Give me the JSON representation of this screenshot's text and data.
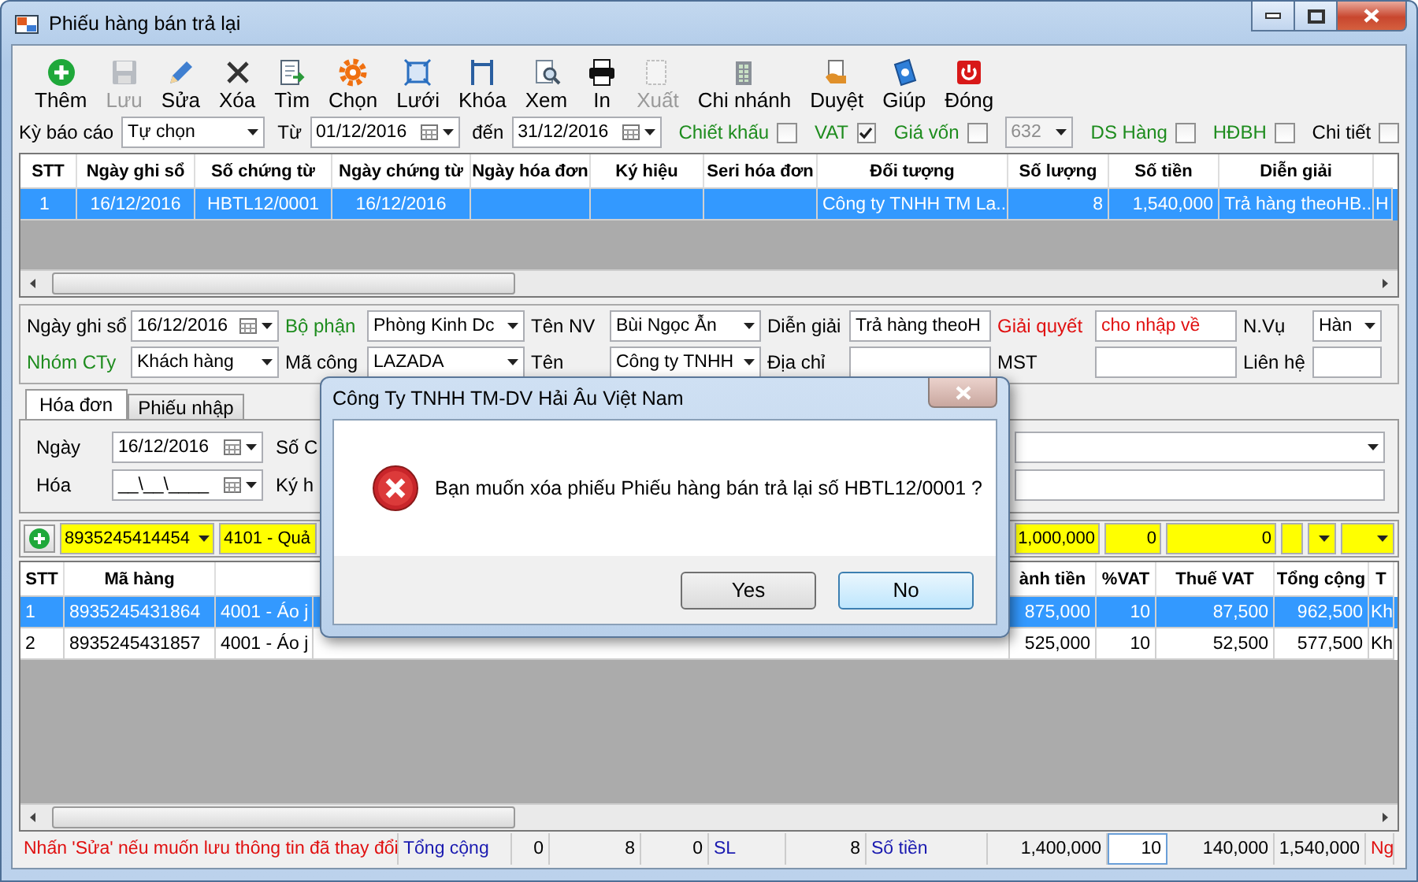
{
  "window": {
    "title": "Phiếu hàng bán trả lại"
  },
  "toolbar": [
    {
      "label": "Thêm",
      "kind": "add",
      "disabled": false
    },
    {
      "label": "Lưu",
      "kind": "save",
      "disabled": true
    },
    {
      "label": "Sửa",
      "kind": "edit",
      "disabled": false
    },
    {
      "label": "Xóa",
      "kind": "delete",
      "disabled": false
    },
    {
      "label": "Tìm",
      "kind": "find",
      "disabled": false
    },
    {
      "label": "Chọn",
      "kind": "select",
      "disabled": false
    },
    {
      "label": "Lưới",
      "kind": "grid",
      "disabled": false
    },
    {
      "label": "Khóa",
      "kind": "lock",
      "disabled": false
    },
    {
      "label": "Xem",
      "kind": "view",
      "disabled": false
    },
    {
      "label": "In",
      "kind": "print",
      "disabled": false
    },
    {
      "label": "Xuất",
      "kind": "export",
      "disabled": true
    },
    {
      "label": "Chi nhánh",
      "kind": "branch",
      "disabled": false
    },
    {
      "label": "Duyệt",
      "kind": "approve",
      "disabled": false
    },
    {
      "label": "Giúp",
      "kind": "help",
      "disabled": false
    },
    {
      "label": "Đóng",
      "kind": "close",
      "disabled": false
    }
  ],
  "filter": {
    "period_label": "Kỳ báo cáo",
    "period": "Tự chọn",
    "from_label": "Từ",
    "from": "01/12/2016",
    "to_label": "đến",
    "to": "31/12/2016",
    "options": [
      {
        "kind": "checkbox",
        "label": "Chiết khấu",
        "color": "#1e8c1e",
        "checked": false
      },
      {
        "kind": "checkbox",
        "label": "VAT",
        "color": "#1e8c1e",
        "checked": true
      },
      {
        "kind": "checkbox",
        "label": "Giá vốn",
        "color": "#1e8c1e",
        "checked": false
      },
      {
        "kind": "combo",
        "value": "632",
        "disabled": true
      },
      {
        "kind": "checkbox",
        "label": "DS Hàng",
        "color": "#1e8c1e",
        "checked": false
      },
      {
        "kind": "checkbox",
        "label": "HĐBH",
        "color": "#1e8c1e",
        "checked": false
      },
      {
        "kind": "checkbox",
        "label": "Chi tiết",
        "color": "#000000",
        "checked": false
      }
    ]
  },
  "voucher_table": {
    "columns": [
      "STT",
      "Ngày ghi sổ",
      "Số chứng từ",
      "Ngày chứng từ",
      "Ngày hóa đơn",
      "Ký hiệu",
      "Seri hóa đơn",
      "Đối tượng",
      "Số lượng",
      "Số tiền",
      "Diễn giải"
    ],
    "rows": [
      {
        "selected": true,
        "cells": [
          "1",
          "16/12/2016",
          "HBTL12/0001",
          "16/12/2016",
          null,
          null,
          null,
          "Công ty TNHH TM La...",
          "8",
          "1,540,000",
          "Trả hàng theoHB...",
          "H"
        ]
      }
    ]
  },
  "form": {
    "rows": [
      [
        {
          "label": "Ngày ghi sổ",
          "color": "#000000",
          "kind": "date",
          "value": "16/12/2016"
        },
        {
          "label": "Bộ phận",
          "color": "#1e8c1e",
          "kind": "combo",
          "value": "Phòng Kinh Dc"
        },
        {
          "label": "Tên NV",
          "color": "#000000",
          "kind": "combo",
          "value": "Bùi Ngọc Ẫn"
        },
        {
          "label": "Diễn giải",
          "color": "#000000",
          "kind": "text",
          "value": "Trả hàng theoH"
        },
        {
          "label": "Giải quyết",
          "color": "#e01010",
          "kind": "text",
          "value": "cho nhập về"
        },
        {
          "label": "N.Vụ",
          "color": "#000000",
          "kind": "combo",
          "value": "Hàn"
        }
      ],
      [
        {
          "label": "Nhóm CTy",
          "color": "#1e8c1e",
          "kind": "combo",
          "value": "Khách hàng"
        },
        {
          "label": "Mã công",
          "color": "#000000",
          "kind": "combo",
          "value": "LAZADA"
        },
        {
          "label": "Tên",
          "color": "#000000",
          "kind": "combo",
          "value": "Công ty TNHH"
        },
        {
          "label": "Địa chỉ",
          "color": "#000000",
          "kind": "text"
        },
        {
          "label": "MST",
          "color": "#000000",
          "kind": "text"
        },
        {
          "label": "Liên hệ",
          "color": "#000000",
          "kind": "text"
        }
      ]
    ]
  },
  "tabs": [
    {
      "label": "Hóa đơn",
      "selected": true
    },
    {
      "label": "Phiếu nhập",
      "selected": false
    }
  ],
  "invoice": {
    "rows": [
      {
        "label": "Ngày",
        "value": "16/12/2016",
        "side_label": "Số C",
        "kind": "combo"
      },
      {
        "label": "Hóa",
        "value": "__\\__\\____",
        "side_label": "Ký h",
        "kind": "text"
      }
    ]
  },
  "entry": {
    "code": "8935245414454",
    "item": "4101 - Quả",
    "amount": "1,000,000",
    "vat": "0",
    "tax": "0"
  },
  "items_table": {
    "columns": [
      {
        "label": "STT"
      },
      {
        "label": "Mã hàng"
      },
      {},
      {},
      {
        "label": "ành tiền"
      },
      {
        "label": "%VAT"
      },
      {
        "label": "Thuế VAT"
      },
      {
        "label": "Tổng cộng"
      },
      {
        "label": "T"
      }
    ],
    "rows": [
      {
        "selected": true,
        "cells": [
          "1",
          "8935245431864",
          "4001 - Áo j",
          null,
          "875,000",
          "10",
          "87,500",
          "962,500",
          "Kh"
        ]
      },
      {
        "selected": false,
        "cells": [
          "2",
          "8935245431857",
          "4001 - Áo j",
          null,
          "525,000",
          "10",
          "52,500",
          "577,500",
          "Kh"
        ]
      }
    ]
  },
  "status": [
    {
      "kind": "note",
      "text": "Nhấn 'Sửa' nếu muốn lưu thông tin đã thay đổi"
    },
    {
      "kind": "label",
      "text": "Tổng cộng"
    },
    {
      "kind": "value",
      "text": "0"
    },
    {
      "kind": "value",
      "text": "8"
    },
    {
      "kind": "value",
      "text": "0"
    },
    {
      "kind": "label",
      "text": "SL"
    },
    {
      "kind": "value",
      "text": "8"
    },
    {
      "kind": "label",
      "text": "Số tiền"
    },
    {
      "kind": "value",
      "text": "1,400,000"
    },
    {
      "kind": "input",
      "text": "10"
    },
    {
      "kind": "value",
      "text": "140,000"
    },
    {
      "kind": "value",
      "text": "1,540,000"
    },
    {
      "kind": "note",
      "text": "Ng"
    }
  ],
  "dialog": {
    "title": "Công Ty TNHH TM-DV Hải Âu Việt Nam",
    "message": "Bạn muốn xóa phiếu Phiếu hàng bán trả lại số HBTL12/0001 ?",
    "buttons": [
      {
        "label": "Yes",
        "focused": false
      },
      {
        "label": "No",
        "focused": true
      }
    ]
  }
}
